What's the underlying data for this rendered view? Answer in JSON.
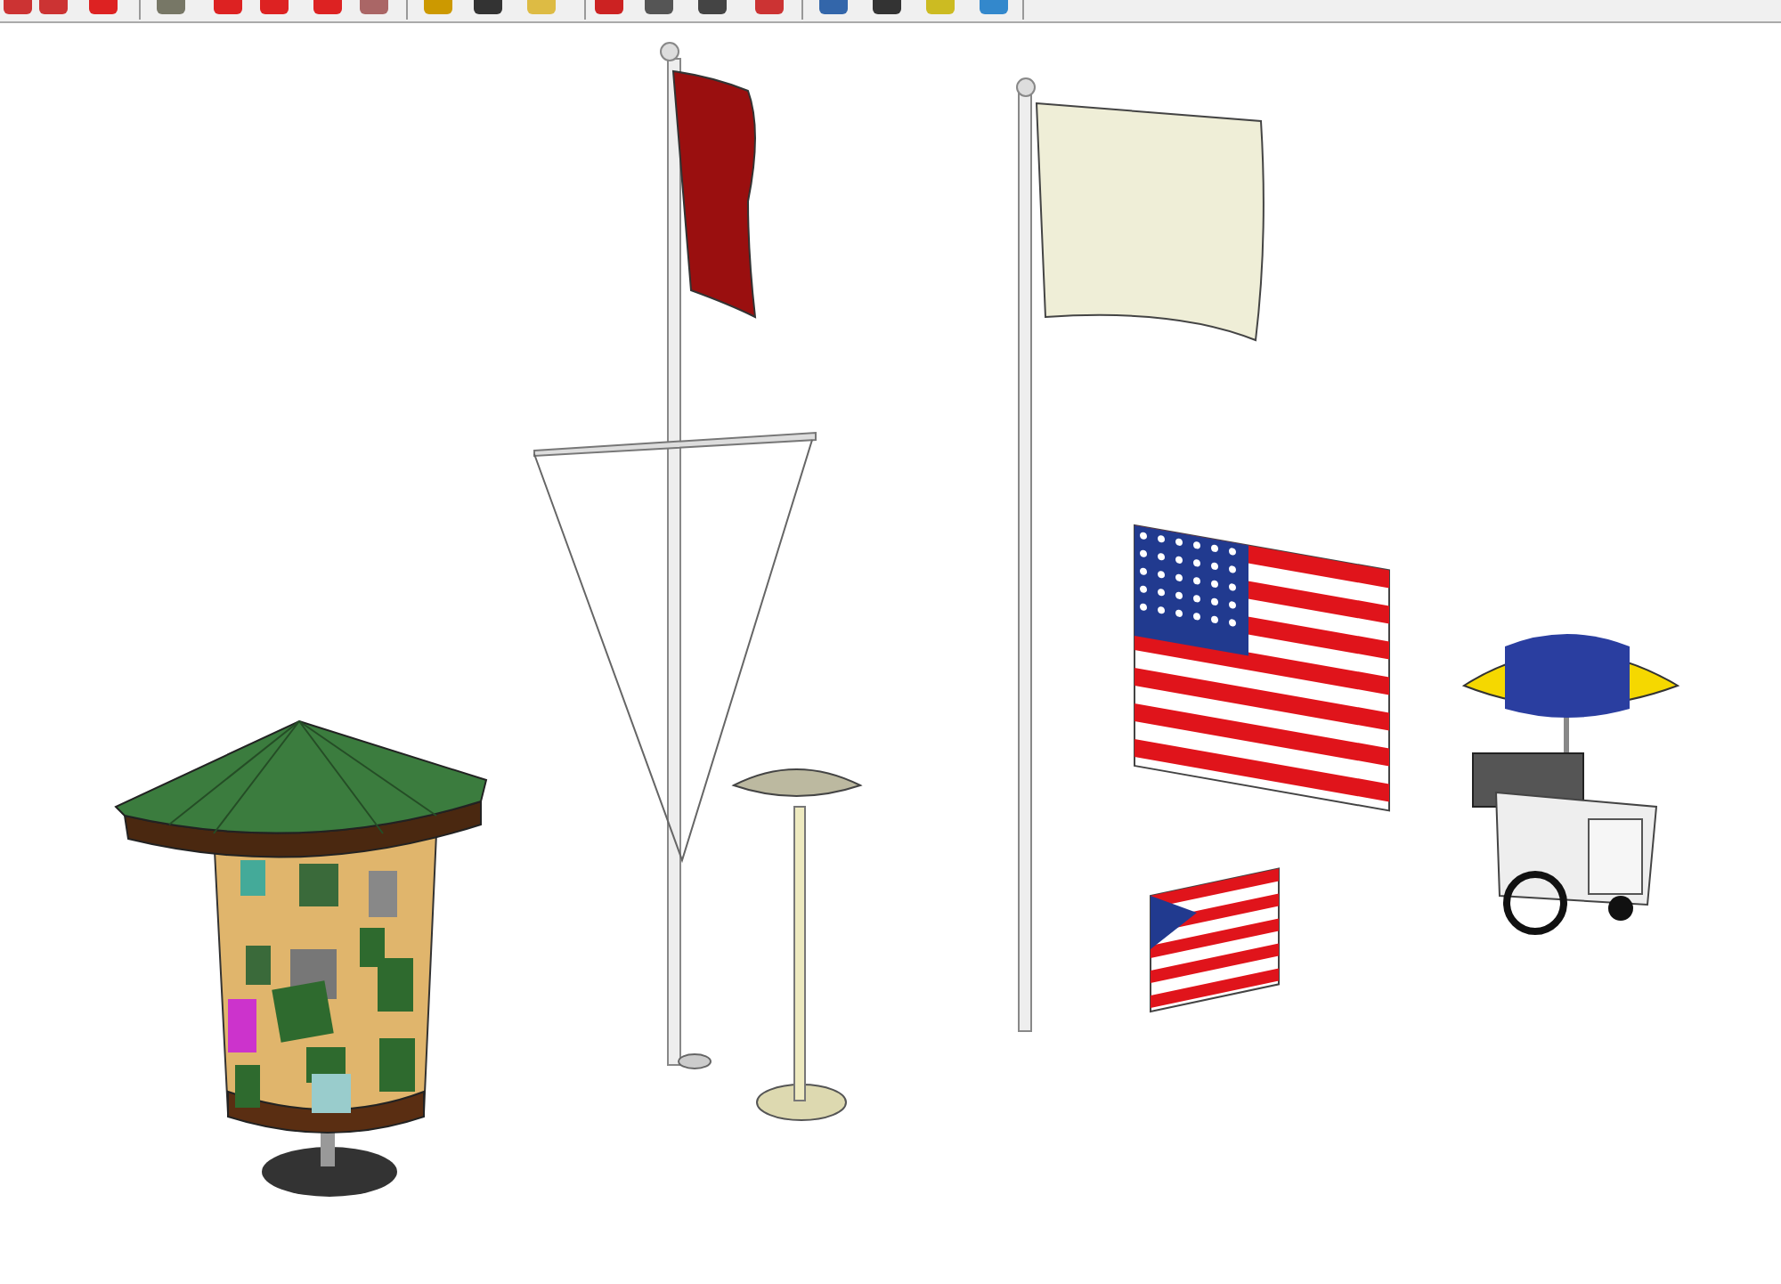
{
  "viewport": {
    "models": [
      {
        "kind": "kiosk"
      },
      {
        "kind": "banner-pole"
      },
      {
        "kind": "lamp"
      },
      {
        "kind": "flag-pole"
      },
      {
        "kind": "us-flag-large"
      },
      {
        "kind": "us-flag-small"
      },
      {
        "kind": "cart"
      }
    ]
  }
}
